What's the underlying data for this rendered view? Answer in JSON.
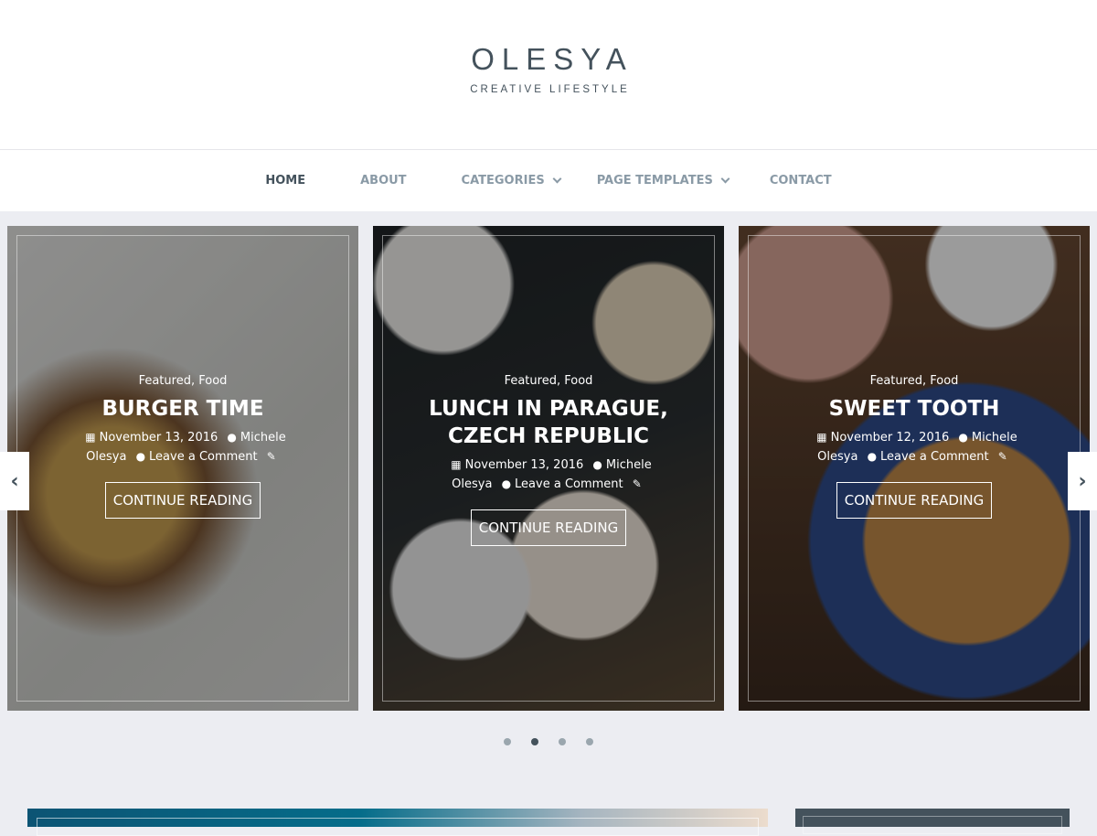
{
  "site": {
    "title": "OLESYA",
    "tagline": "CREATIVE LIFESTYLE"
  },
  "nav": {
    "items": [
      {
        "label": "HOME",
        "active": true,
        "has_dropdown": false
      },
      {
        "label": "ABOUT",
        "active": false,
        "has_dropdown": false
      },
      {
        "label": "CATEGORIES",
        "active": false,
        "has_dropdown": true
      },
      {
        "label": "PAGE TEMPLATES",
        "active": false,
        "has_dropdown": true
      },
      {
        "label": "CONTACT",
        "active": false,
        "has_dropdown": false
      }
    ]
  },
  "slider": {
    "prev_icon": "chevron-left-icon",
    "next_icon": "chevron-right-icon",
    "slides": [
      {
        "cat1": "Featured",
        "cat2": "Food",
        "title": "BURGER TIME",
        "date": "November 13, 2016",
        "author": "Michele Olesya",
        "comments": "Leave a Comment",
        "button": "CONTINUE READING"
      },
      {
        "cat1": "Featured",
        "cat2": "Food",
        "title": "LUNCH IN PARAGUE, CZECH REPUBLIC",
        "date": "November 13, 2016",
        "author": "Michele Olesya",
        "comments": "Leave a Comment",
        "button": "CONTINUE READING"
      },
      {
        "cat1": "Featured",
        "cat2": "Food",
        "title": "SWEET TOOTH",
        "date": "November 12, 2016",
        "author": "Michele Olesya",
        "comments": "Leave a Comment",
        "button": "CONTINUE READING"
      }
    ],
    "dots": {
      "count": 4,
      "active_index": 1
    }
  },
  "colors": {
    "accent": "#44525c",
    "nav_inactive": "#8a9aa6",
    "background": "#ecedf2"
  }
}
